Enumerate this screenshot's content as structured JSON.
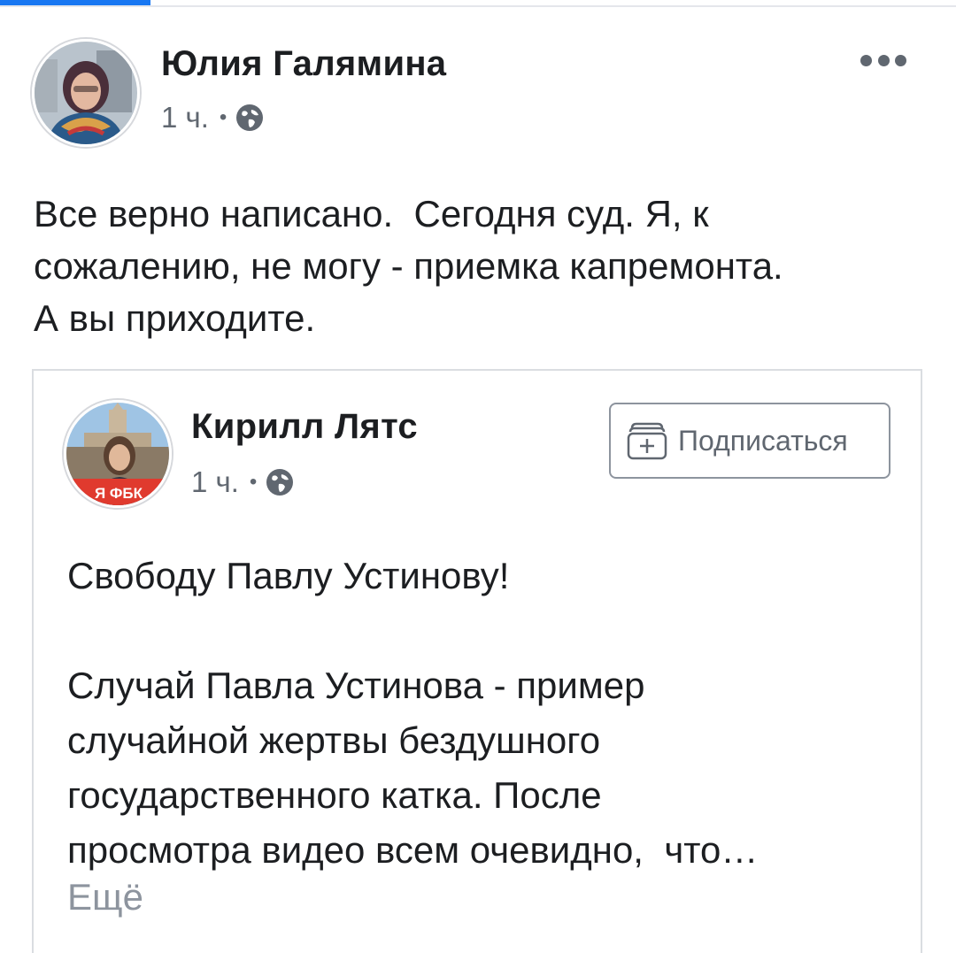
{
  "post": {
    "author": "Юлия Галямина",
    "time": "1 ч.",
    "separator": "•",
    "privacy_icon": "globe-icon",
    "menu_icon": "more-dots-icon",
    "text": "Все верно написано.  Сегодня суд. Я, к\nсожалению, не могу - приемка капремонта.\nА вы приходите."
  },
  "shared": {
    "author": "Кирилл Лятс",
    "time": "1 ч.",
    "separator": "•",
    "privacy_icon": "globe-icon",
    "avatar_badge": "Я ФБК",
    "subscribe_label": "Подписаться",
    "subscribe_icon": "follow-icon",
    "text": "Свободу Павлу Устинову!\n\nСлучай Павла Устинова - пример\nслучайной жертвы бездушного\nгосударственного катка. После\nпросмотра видео всем очевидно,  что…",
    "more_label": "Ещё"
  },
  "colors": {
    "accent": "#1877f2",
    "text": "#1c1e21",
    "meta": "#606770",
    "badge": "#e03a2e"
  }
}
